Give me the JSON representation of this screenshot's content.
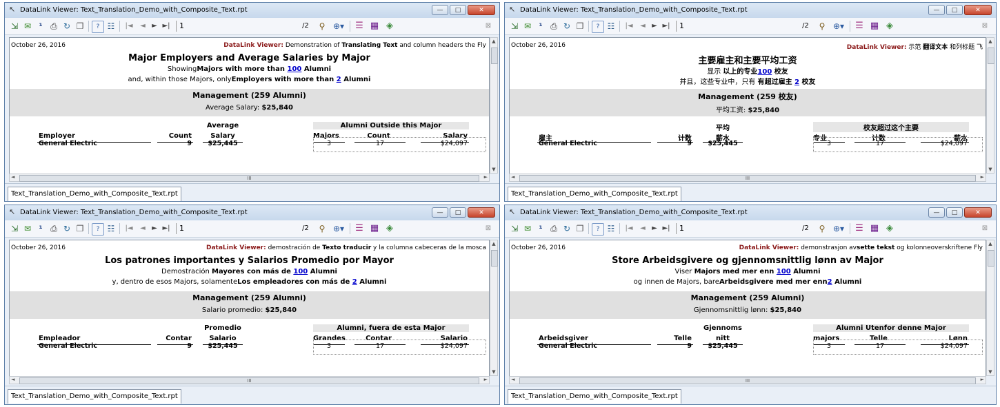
{
  "common": {
    "window_title": "DataLink Viewer: Text_Translation_Demo_with_Composite_Text.rpt",
    "page_current": "1",
    "page_count": "/2",
    "tab_label": "Text_Translation_Demo_with_Composite_Text.rpt",
    "date": "October 26, 2016",
    "banner_app": "DataLink Viewer:",
    "row": {
      "employer": "General Electric",
      "count": "9",
      "avg_salary": "$25,445",
      "majors": "3",
      "alumni_count": "17",
      "salary": "$24,097"
    },
    "scroll_up": "▲",
    "scroll_down": "▼",
    "scroll_left": "◄",
    "scroll_right": "►",
    "scroll_grip": "III",
    "win_min": "—",
    "win_max": "□",
    "win_close": "✕"
  },
  "win1": {
    "banner_rest": "Demonstration of ",
    "banner_b": "Translating Text",
    "banner_tail": " and column headers the Fly",
    "title": "Major Employers and Average Salaries by Major",
    "l2_a": "Showing",
    "l2_b": "Majors with more than ",
    "l2_link": "100",
    "l2_c": " Alumni",
    "l3_a": "and, within those Majors, only",
    "l3_b": "Employers with more than ",
    "l3_link": "2",
    "l3_c": " Alumni",
    "mgmt": "Management (259 Alumni)",
    "avg_label": "Average Salary: ",
    "avg_value": "$25,840",
    "h_employer": "Employer",
    "h_count": "Count",
    "h_avg1": "Average",
    "h_avg2": "Salary",
    "h_group": "Alumni Outside this Major",
    "h_majors": "Majors",
    "h_count2": "Count",
    "h_salary": "Salary"
  },
  "win2": {
    "banner_rest": "示范 ",
    "banner_b": "翻译文本",
    "banner_tail": " 和列标题 飞",
    "title": "主要雇主和主要平均工资",
    "l2_a": "显示 ",
    "l2_b": "以上的专业",
    "l2_link": "100",
    "l2_c": " 校友",
    "l3_a": "并且，这些专业中，只有 ",
    "l3_b": "有超过雇主 ",
    "l3_link": "2",
    "l3_c": " 校友",
    "mgmt": "Management (259 校友)",
    "avg_label": "平均工资: ",
    "avg_value": "$25,840",
    "h_employer": "雇主",
    "h_count": "计数",
    "h_avg1": "平均",
    "h_avg2": "薪水",
    "h_group": "校友超过这个主要",
    "h_majors": "专业",
    "h_count2": "计数",
    "h_salary": "薪水"
  },
  "win3": {
    "banner_rest": "demostración de ",
    "banner_b": "Texto traducir",
    "banner_tail": " y la columna cabeceras de la mosca",
    "title": "Los patrones importantes y Salarios Promedio por Mayor",
    "l2_a": "Demostración ",
    "l2_b": "Mayores con más de ",
    "l2_link": "100",
    "l2_c": " Alumni",
    "l3_a": "y, dentro de esos Majors, solamente",
    "l3_b": "Los empleadores con más de ",
    "l3_link": "2",
    "l3_c": " Alumni",
    "mgmt": "Management (259 Alumni)",
    "avg_label": "Salario promedio: ",
    "avg_value": "$25,840",
    "h_employer": "Empleador",
    "h_count": "Contar",
    "h_avg1": "Promedio",
    "h_avg2": "Salario",
    "h_group": "Alumni, fuera de esta Major",
    "h_majors": "Grandes",
    "h_count2": "Contar",
    "h_salary": "Salario"
  },
  "win4": {
    "banner_rest": "demonstrasjon av",
    "banner_b": "sette tekst",
    "banner_tail": " og kolonneoverskriftene Fly",
    "title": "Store Arbeidsgivere og gjennomsnittlig lønn av Major",
    "l2_a": "Viser ",
    "l2_b": "Majors med mer enn ",
    "l2_link": "100",
    "l2_c": " Alumni",
    "l3_a": "og innen de Majors, bare",
    "l3_b": "Arbeidsgivere med mer enn",
    "l3_link": "2",
    "l3_c": " Alumni",
    "mgmt": "Management (259 Alumni)",
    "avg_label": "Gjennomsnittlig lønn: ",
    "avg_value": "$25,840",
    "h_employer": "Arbeidsgiver",
    "h_count": "Telle",
    "h_avg1": "Gjennoms",
    "h_avg2": "nitt",
    "h_group": "Alumni Utenfor denne Major",
    "h_majors": "majors",
    "h_count2": "Telle",
    "h_salary": "Lønn"
  },
  "toolbar_icons": [
    "export-icon",
    "email-icon",
    "page-one-icon",
    "print-icon",
    "refresh-icon",
    "copy-icon",
    "help-icon",
    "group-tree-icon",
    "first-page-icon",
    "prev-page-icon",
    "next-page-icon",
    "last-page-icon",
    "search-icon",
    "zoom-icon",
    "color-scheme-icon",
    "table-icon",
    "cube-icon",
    "close-pane-icon"
  ]
}
